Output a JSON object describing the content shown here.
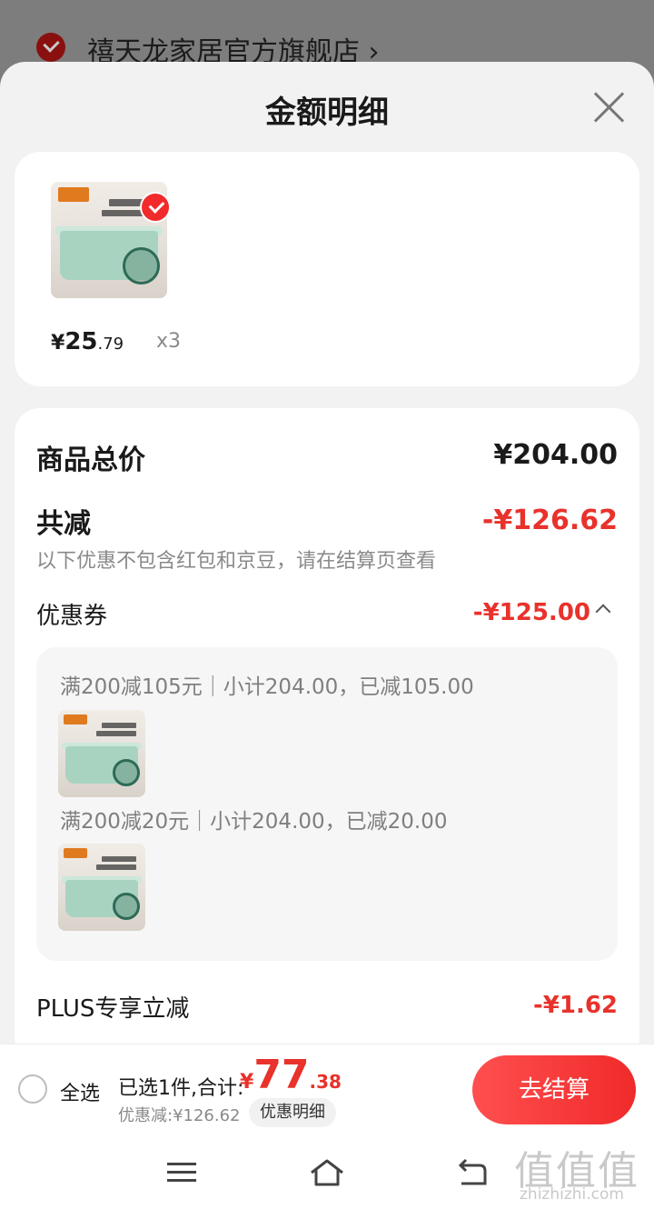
{
  "store": {
    "name": "禧天龙家居官方旗舰店 ›"
  },
  "sheet": {
    "title": "金额明细"
  },
  "item": {
    "price_yen": "¥",
    "price_int": "25",
    "price_dec": ".79",
    "qty": "x3"
  },
  "summary": {
    "total_label": "商品总价",
    "total_value": "¥204.00",
    "reduce_label": "共减",
    "reduce_value": "-¥126.62",
    "reduce_note": "以下优惠不包含红包和京豆，请在结算页查看",
    "coupon_label": "优惠券",
    "coupon_value": "-¥125.00",
    "coupons": [
      {
        "text": "满200减105元｜小计204.00，已减105.00"
      },
      {
        "text": "满200减20元｜小计204.00，已减20.00"
      }
    ],
    "plus_label": "PLUS专享立减",
    "plus_value": "-¥1.62"
  },
  "bottom_bar": {
    "select_all": "全选",
    "selected_text": "已选1件,合计:",
    "total_yen": "¥",
    "total_int": "77",
    "total_dec": ".38",
    "discount_text": "优惠减:¥126.62",
    "detail_chip": "优惠明细",
    "checkout_label": "去结算"
  },
  "watermark": {
    "text": "值值值",
    "sub": "zhizhizhi.com"
  },
  "colors": {
    "accent_red": "#e8322b",
    "button_red": "#f02a2a",
    "panel_bg": "#f2f2f2"
  },
  "icons": [
    "check-circle-icon",
    "close-icon",
    "chevron-up-icon",
    "menu-icon",
    "home-icon",
    "back-icon"
  ]
}
